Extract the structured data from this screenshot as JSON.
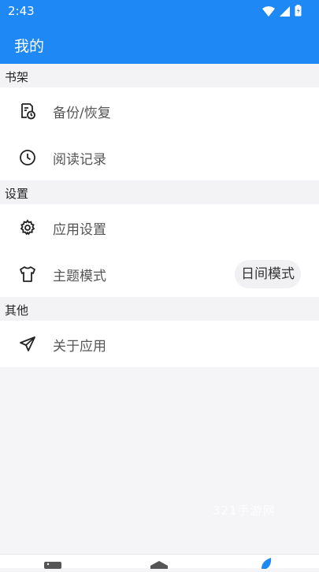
{
  "status_bar": {
    "time": "2:43"
  },
  "app_bar": {
    "title": "我的"
  },
  "sections": [
    {
      "header": "书架",
      "items": [
        {
          "label": "备份/恢复",
          "icon": "backup-restore-icon"
        },
        {
          "label": "阅读记录",
          "icon": "clock-icon"
        }
      ]
    },
    {
      "header": "设置",
      "items": [
        {
          "label": "应用设置",
          "icon": "gear-icon"
        },
        {
          "label": "主题模式",
          "icon": "tshirt-icon",
          "value": "日间模式"
        }
      ]
    },
    {
      "header": "其他",
      "items": [
        {
          "label": "关于应用",
          "icon": "send-icon"
        }
      ]
    }
  ],
  "watermark": "321手游网",
  "colors": {
    "accent": "#1e88f5",
    "background": "#f5f4f7"
  }
}
